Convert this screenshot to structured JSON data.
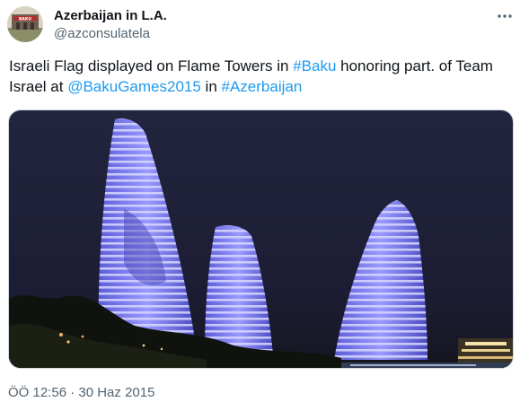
{
  "author": {
    "name": "Azerbaijan in L.A.",
    "handle": "@azconsulatela",
    "avatar_badge": "BAKU"
  },
  "tweet": {
    "text_parts": [
      {
        "text": "Israeli Flag displayed on Flame Towers in ",
        "type": "text"
      },
      {
        "text": "#Baku",
        "type": "link"
      },
      {
        "text": " honoring part. of Team Israel at ",
        "type": "text"
      },
      {
        "text": "@BakuGames2015",
        "type": "link"
      },
      {
        "text": " in ",
        "type": "text"
      },
      {
        "text": "#Azerbaijan",
        "type": "link"
      }
    ],
    "timestamp": "ÖÖ 12:56 · 30 Haz 2015"
  },
  "icons": {
    "more": "more-options-icon"
  },
  "colors": {
    "link": "#1d9bf0",
    "secondary_text": "#536471",
    "primary_text": "#0f1419",
    "night_sky": "#1a1c3a",
    "tower_light": "#8c8cff"
  }
}
